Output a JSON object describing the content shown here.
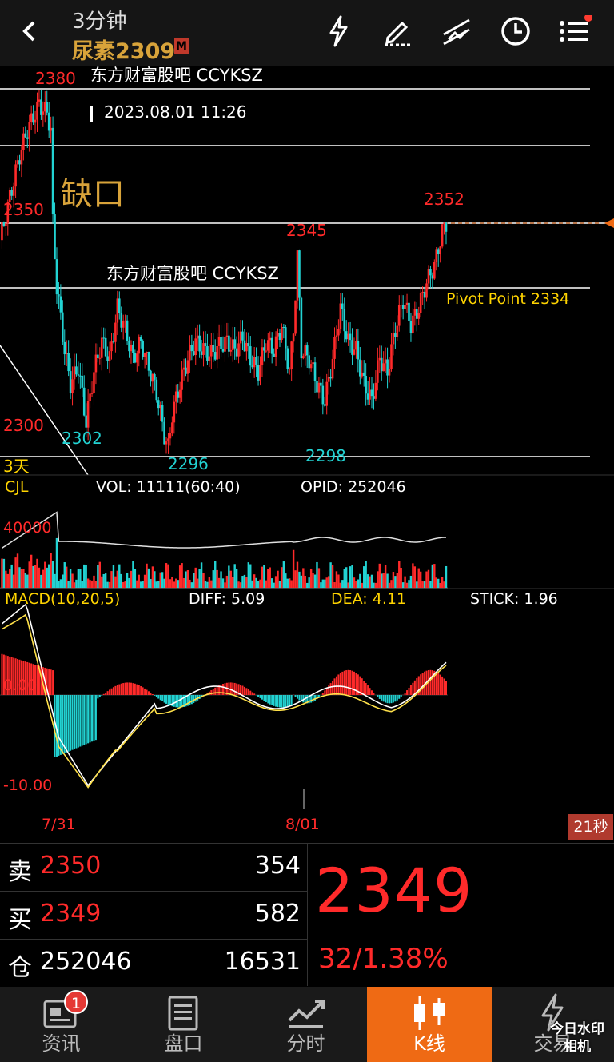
{
  "header": {
    "timeframe": "3分钟",
    "symbol": "尿素2309",
    "symbol_badge": "M",
    "icons": [
      "back-icon",
      "lightning-icon",
      "pen-icon",
      "trend-lines-icon",
      "clock-icon",
      "menu-icon"
    ]
  },
  "overlay": {
    "watermark_top": "东方财富股吧 CCYKSZ",
    "watermark_mid": "东方财富股吧 CCYKSZ",
    "datetime": "2023.08.01 11:26",
    "gap_label": "缺口",
    "pivot": "Pivot Point 2334",
    "days_label": "3天"
  },
  "price_labels": {
    "p2380": "2380",
    "p2350": "2350",
    "p2300": "2300",
    "p2352": "2352",
    "p2345": "2345",
    "p2302": "2302",
    "p2296": "2296",
    "p2298": "2298"
  },
  "volume": {
    "name": "CJL",
    "vol": "VOL: 11111(60:40)",
    "opid": "OPID: 252046",
    "scale": "40000"
  },
  "macd": {
    "name": "MACD(10,20,5)",
    "diff": "DIFF: 5.09",
    "dea": "DEA: 4.11",
    "stick": "STICK: 1.96",
    "zero": "0.00",
    "low": "-10.00"
  },
  "time_axis": {
    "d1": "7/31",
    "d2": "8/01",
    "countdown": "21秒"
  },
  "quote": {
    "sell_label": "卖",
    "sell_price": "2350",
    "sell_qty": "354",
    "buy_label": "买",
    "buy_price": "2349",
    "buy_qty": "582",
    "oi_label": "仓",
    "oi_value": "252046",
    "oi_change": "16531",
    "last_price": "2349",
    "change": "32/1.38%"
  },
  "tabs": [
    {
      "label": "资讯",
      "badge": "1"
    },
    {
      "label": "盘口"
    },
    {
      "label": "分时"
    },
    {
      "label": "K线"
    },
    {
      "label": "交易"
    }
  ],
  "watermark_corner": "今日水印\n相机",
  "colors": {
    "up": "#ff2a2a",
    "down": "#22d3d3",
    "accent": "#ef6a14",
    "gold": "#d8a33a"
  }
}
